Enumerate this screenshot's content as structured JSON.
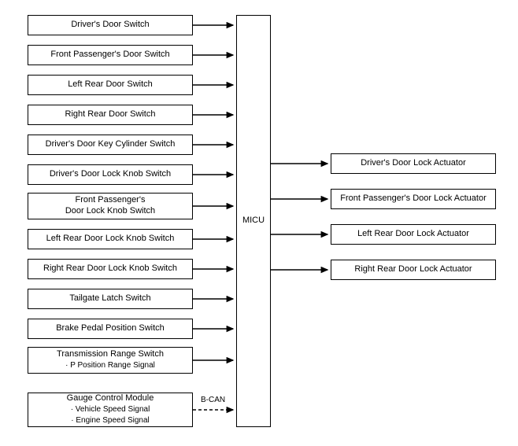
{
  "central": {
    "label": "MICU"
  },
  "inputs": [
    {
      "label": "Driver's Door Switch"
    },
    {
      "label": "Front Passenger's Door Switch"
    },
    {
      "label": "Left Rear Door Switch"
    },
    {
      "label": "Right Rear Door Switch"
    },
    {
      "label": "Driver's Door Key Cylinder Switch"
    },
    {
      "label": "Driver's Door Lock Knob Switch"
    },
    {
      "line1": "Front Passenger's",
      "line2": "Door Lock Knob Switch"
    },
    {
      "label": "Left Rear Door Lock Knob Switch"
    },
    {
      "label": "Right Rear Door Lock Knob Switch"
    },
    {
      "label": "Tailgate Latch Switch"
    },
    {
      "label": "Brake Pedal Position Switch"
    },
    {
      "line1": "Transmission Range Switch",
      "line2": "· P Position Range Signal"
    },
    {
      "line1": "Gauge Control Module",
      "line2": "· Vehicle Speed Signal",
      "line3": "· Engine Speed Signal"
    }
  ],
  "outputs": [
    {
      "label": "Driver's Door Lock Actuator"
    },
    {
      "label": "Front Passenger's Door Lock Actuator"
    },
    {
      "label": "Left Rear Door Lock Actuator"
    },
    {
      "label": "Right Rear Door Lock Actuator"
    }
  ],
  "bcan_label": "B-CAN"
}
